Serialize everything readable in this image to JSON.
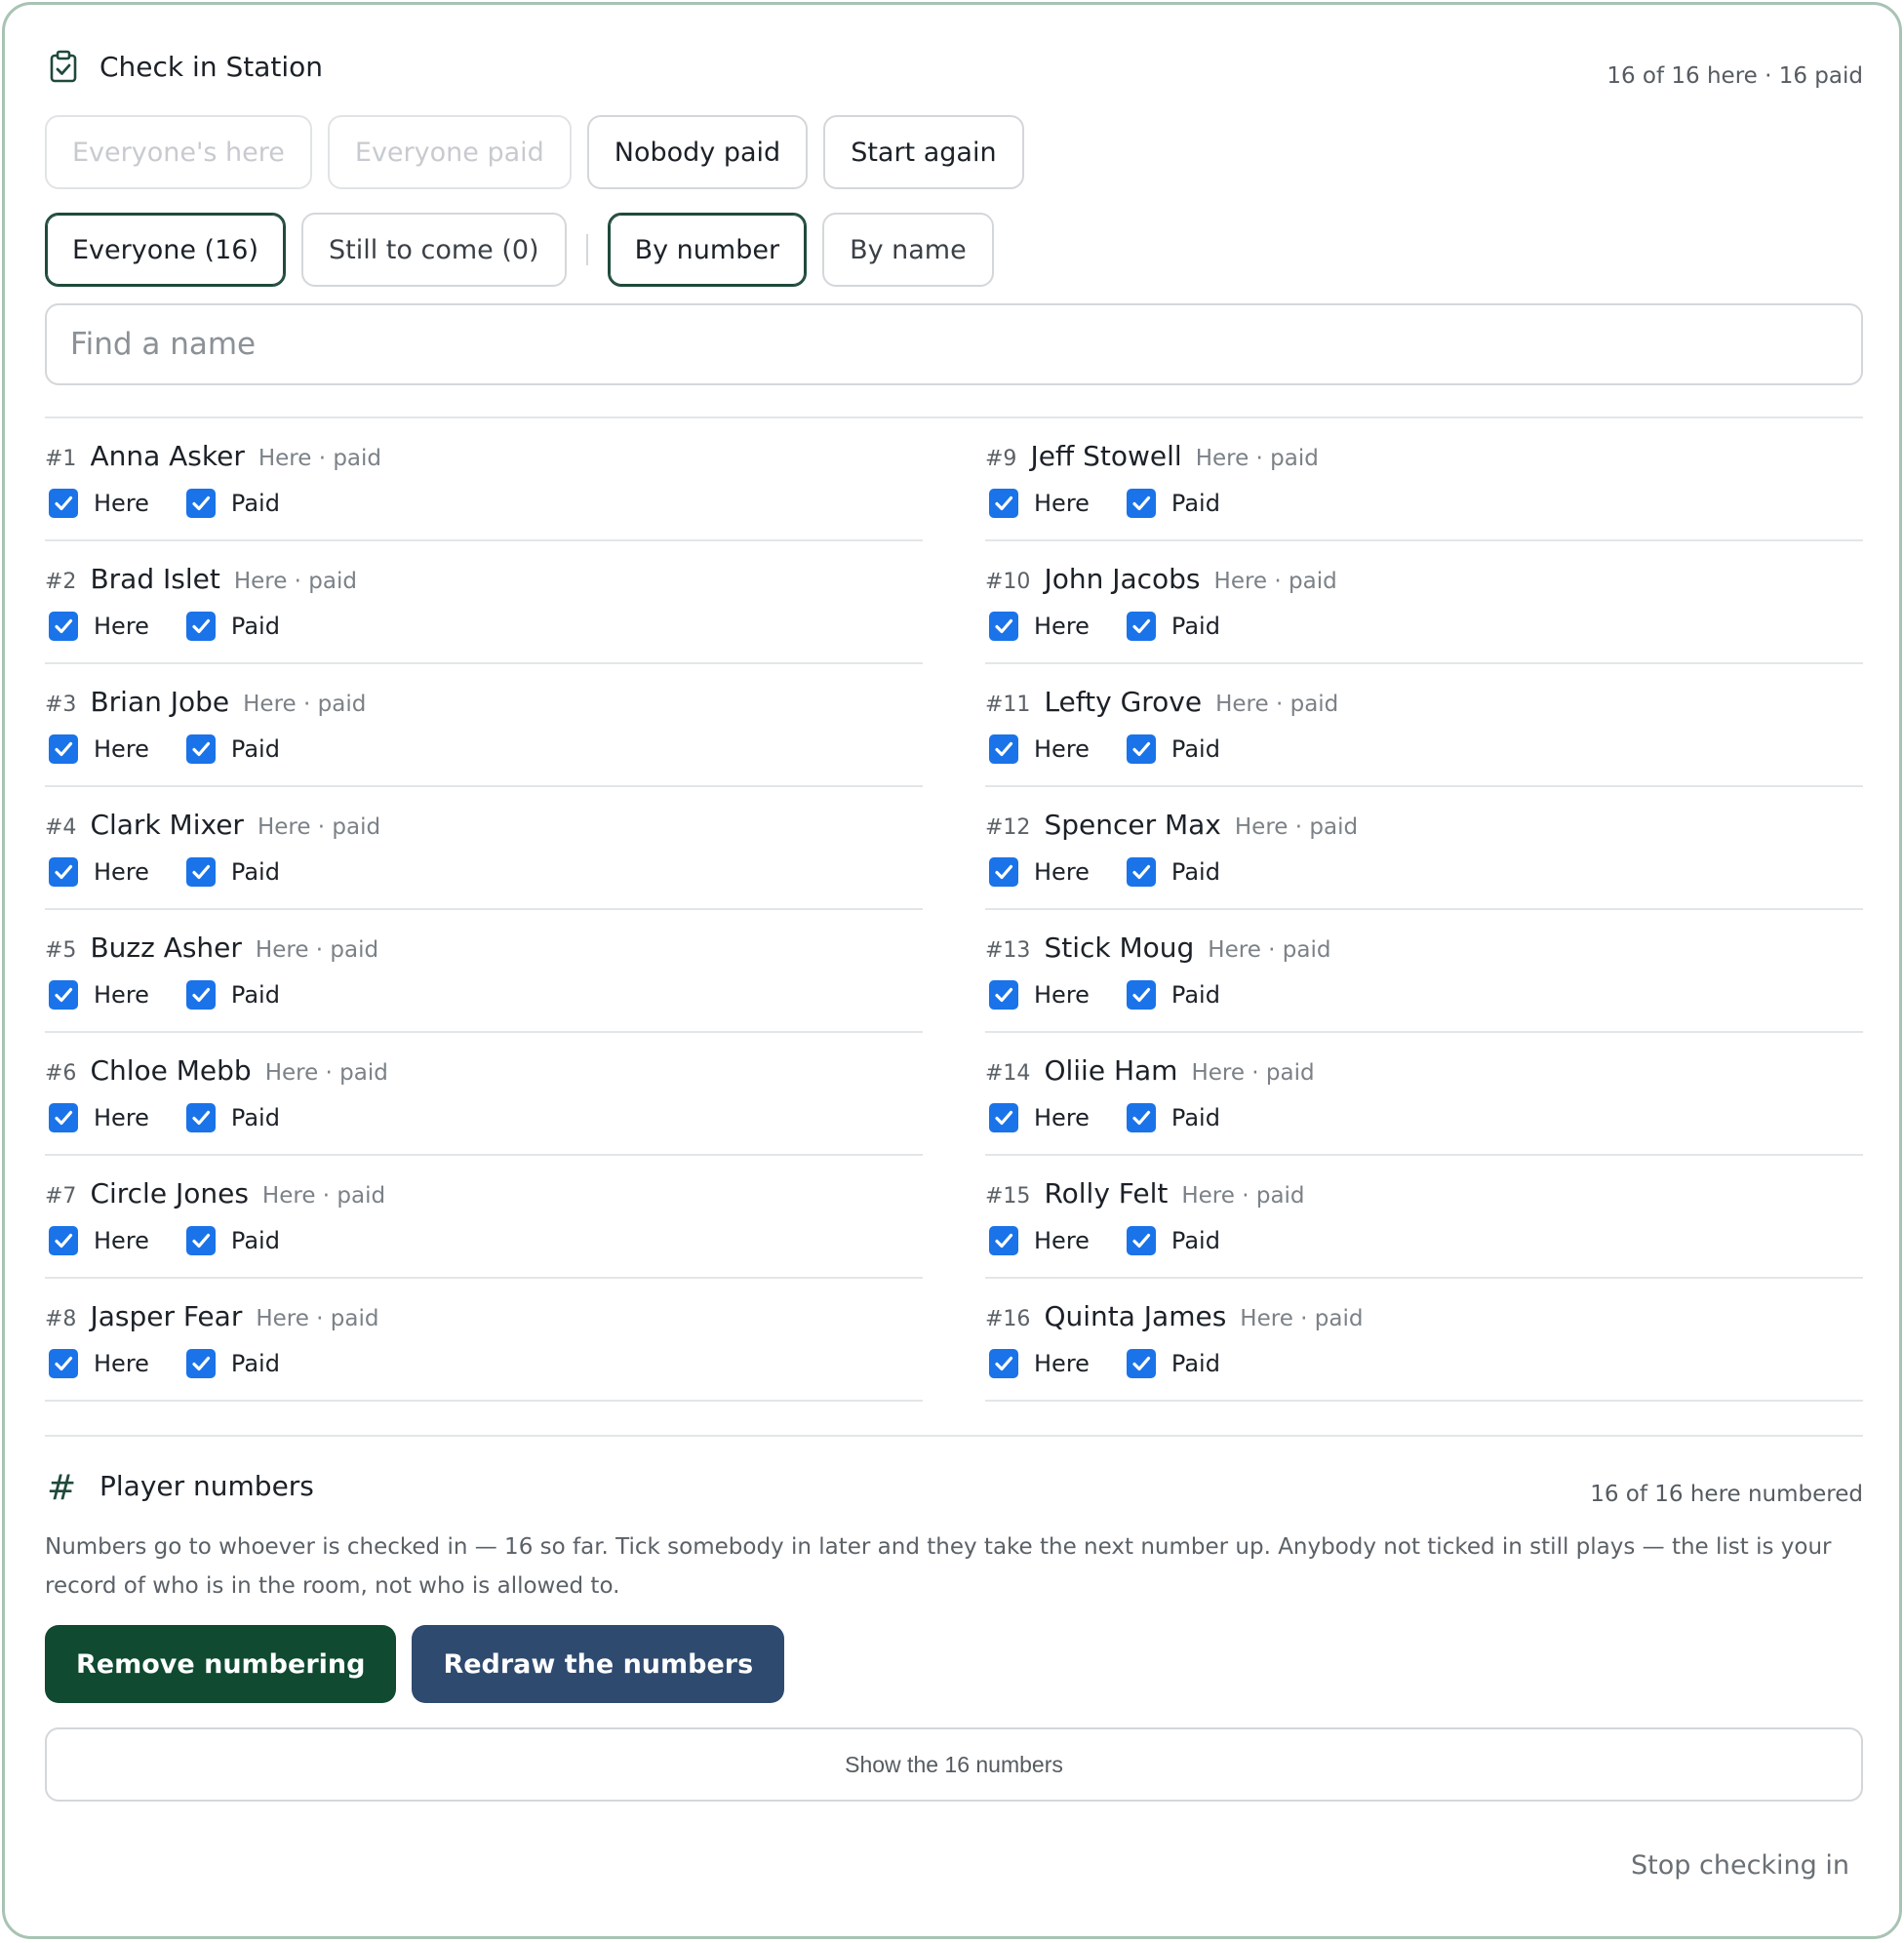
{
  "header": {
    "title": "Check in Station",
    "summary": "16 of 16 here · 16 paid"
  },
  "actions": [
    {
      "label": "Everyone's here",
      "enabled": false
    },
    {
      "label": "Everyone paid",
      "enabled": false
    },
    {
      "label": "Nobody paid",
      "enabled": true
    },
    {
      "label": "Start again",
      "enabled": true
    }
  ],
  "filters": {
    "everyone": "Everyone (16)",
    "still_to_come": "Still to come (0)",
    "by_number": "By number",
    "by_name": "By name",
    "active_filter": "Everyone (16)",
    "active_sort": "By number"
  },
  "search": {
    "placeholder": "Find a name",
    "value": ""
  },
  "labels": {
    "here": "Here",
    "paid": "Paid"
  },
  "players": [
    {
      "number": "#1",
      "name": "Anna Asker",
      "status": "Here · paid",
      "here": true,
      "paid": true
    },
    {
      "number": "#2",
      "name": "Brad Islet",
      "status": "Here · paid",
      "here": true,
      "paid": true
    },
    {
      "number": "#3",
      "name": "Brian Jobe",
      "status": "Here · paid",
      "here": true,
      "paid": true
    },
    {
      "number": "#4",
      "name": "Clark Mixer",
      "status": "Here · paid",
      "here": true,
      "paid": true
    },
    {
      "number": "#5",
      "name": "Buzz Asher",
      "status": "Here · paid",
      "here": true,
      "paid": true
    },
    {
      "number": "#6",
      "name": "Chloe Mebb",
      "status": "Here · paid",
      "here": true,
      "paid": true
    },
    {
      "number": "#7",
      "name": "Circle Jones",
      "status": "Here · paid",
      "here": true,
      "paid": true
    },
    {
      "number": "#8",
      "name": "Jasper Fear",
      "status": "Here · paid",
      "here": true,
      "paid": true
    },
    {
      "number": "#9",
      "name": "Jeff Stowell",
      "status": "Here · paid",
      "here": true,
      "paid": true
    },
    {
      "number": "#10",
      "name": "John Jacobs",
      "status": "Here · paid",
      "here": true,
      "paid": true
    },
    {
      "number": "#11",
      "name": "Lefty Grove",
      "status": "Here · paid",
      "here": true,
      "paid": true
    },
    {
      "number": "#12",
      "name": "Spencer Max",
      "status": "Here · paid",
      "here": true,
      "paid": true
    },
    {
      "number": "#13",
      "name": "Stick Moug",
      "status": "Here · paid",
      "here": true,
      "paid": true
    },
    {
      "number": "#14",
      "name": "Oliie Ham",
      "status": "Here · paid",
      "here": true,
      "paid": true
    },
    {
      "number": "#15",
      "name": "Rolly Felt",
      "status": "Here · paid",
      "here": true,
      "paid": true
    },
    {
      "number": "#16",
      "name": "Quinta James",
      "status": "Here · paid",
      "here": true,
      "paid": true
    }
  ],
  "player_numbers": {
    "title": "Player numbers",
    "summary": "16 of 16 here numbered",
    "description": "Numbers go to whoever is checked in — 16 so far. Tick somebody in later and they take the next number up. Anybody not ticked in still plays — the list is your record of who is in the room, not who is allowed to.",
    "remove_button": "Remove numbering",
    "redraw_button": "Redraw the numbers",
    "show_button": "Show the 16 numbers"
  },
  "footer": {
    "stop_link": "Stop checking in"
  },
  "icons": {
    "title_icon": "clipboard-check-icon",
    "section_icon": "hash-icon",
    "checkbox_icon": "check-icon"
  },
  "colors": {
    "accent_green": "#0f4a31",
    "accent_navy": "#2e4a6f",
    "checkbox_blue": "#1a73e8",
    "frame_border": "#a8c3b3"
  }
}
